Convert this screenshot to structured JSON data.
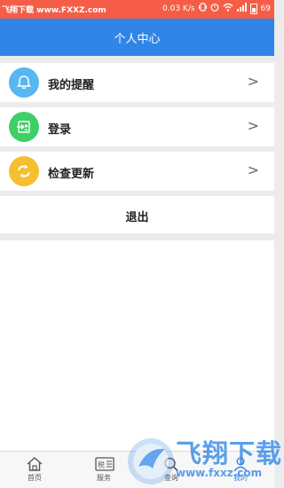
{
  "status_bar": {
    "watermark_text": "飞翔下载 www.FXXZ.com",
    "speed": "0.03 K/s",
    "battery": "69"
  },
  "header": {
    "title": "个人中心"
  },
  "menu": [
    {
      "label": "我的提醒",
      "icon": "bell-icon",
      "color": "#56b7f2",
      "arrow": ">"
    },
    {
      "label": "登录",
      "icon": "login-icon",
      "color": "#3ecf66",
      "arrow": ">"
    },
    {
      "label": "检查更新",
      "icon": "refresh-icon",
      "color": "#f5c030",
      "arrow": ">"
    }
  ],
  "logout": {
    "label": "退出"
  },
  "tabbar": {
    "items": [
      {
        "label": "首页",
        "icon": "home-icon"
      },
      {
        "label": "服务",
        "icon": "tax-service-icon"
      },
      {
        "label": "查询",
        "icon": "search-icon"
      },
      {
        "label": "我的",
        "icon": "user-icon"
      }
    ]
  },
  "watermark": {
    "logo": "飞翔下载",
    "url": "www.fxxz.com"
  }
}
